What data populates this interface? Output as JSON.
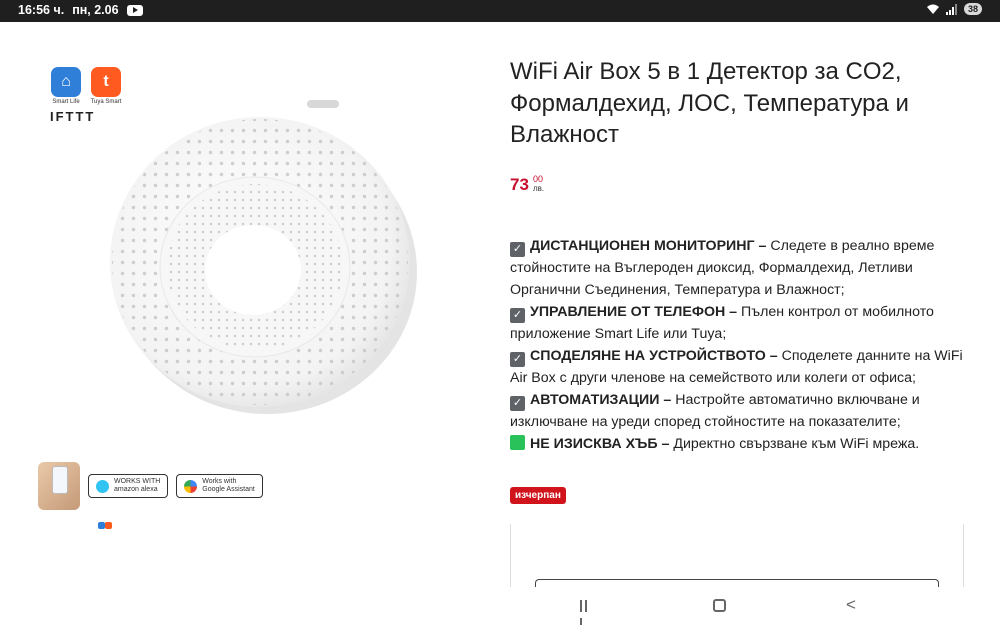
{
  "status_bar": {
    "time": "16:56 ч.",
    "date": "пн, 2.06",
    "battery": "38"
  },
  "gallery": {
    "apps": [
      {
        "label": "Smart Life",
        "icon": "home-icon"
      },
      {
        "label": "Tuya Smart",
        "icon": "tuya-icon"
      }
    ],
    "ifttt": "IFTTT",
    "voice": [
      {
        "line1": "WORKS WITH",
        "line2": "amazon alexa"
      },
      {
        "line1": "Works with",
        "line2": "Google Assistant"
      }
    ]
  },
  "product": {
    "title": "WiFi Air Box 5 в 1 Детектор за CO2, Формалдехид, ЛОС, Температура и Влажност",
    "price_whole": "73",
    "price_cents": "00",
    "currency": "лв.",
    "stock_badge": "изчерпан"
  },
  "features": [
    {
      "icon": "check-icon",
      "heading": "ДИСТАНЦИОНЕН МОНИТОРИНГ –",
      "text": " Следете в реално време стойностите на Въглероден диоксид, Формалдехид, Летливи Органични Съединения, Температура и Влажност;"
    },
    {
      "icon": "check-icon",
      "heading": "УПРАВЛЕНИЕ ОТ ТЕЛЕФОН –",
      "text": "Пълен контрол от мобилното приложение Smart Life или Tuya;"
    },
    {
      "icon": "check-icon",
      "heading": "СПОДЕЛЯНЕ НА УСТРОЙСТВОТО –",
      "text": "Споделете данните на WiFi Air Box с други членове на семейството или колеги от офиса;"
    },
    {
      "icon": "check-icon",
      "heading": "АВТОМАТИЗАЦИИ –",
      "text": "Настройте автоматично включване и изключване на уреди според стойностите на показателите;"
    },
    {
      "icon": "green-square-icon",
      "heading": "НЕ ИЗИСКВА ХЪБ –",
      "text": "Директно свързване към WiFi мрежа."
    }
  ],
  "colors": {
    "price": "#c8102e",
    "badge": "#d1131c",
    "statusbar": "#1f1f1f"
  }
}
